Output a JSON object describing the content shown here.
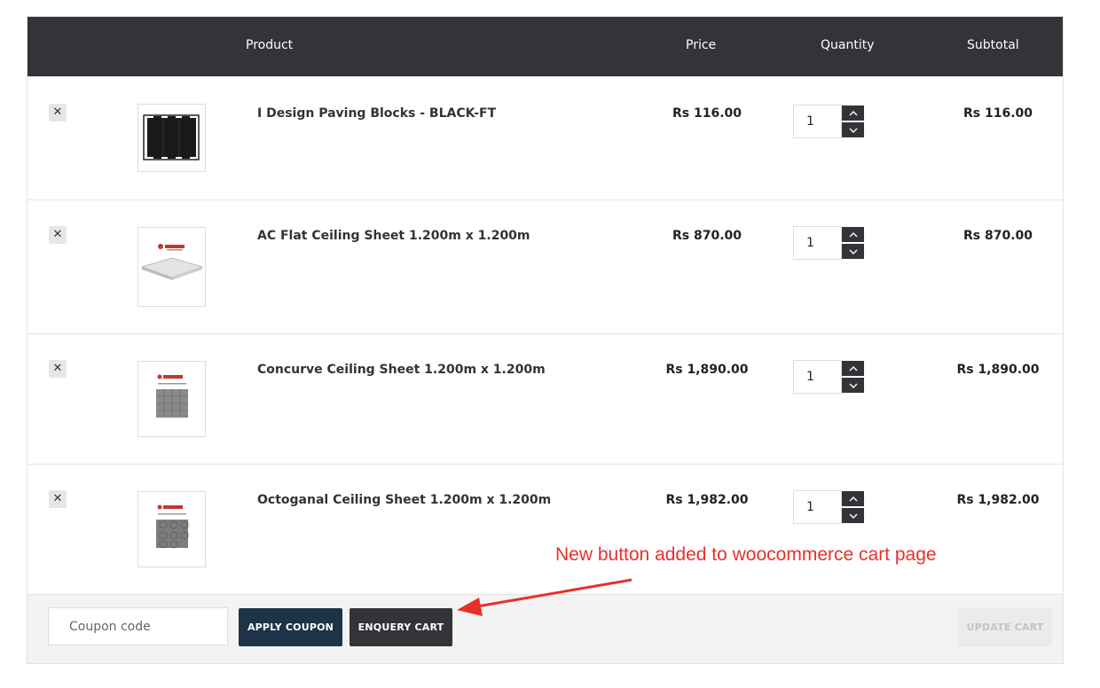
{
  "table": {
    "headers": {
      "product": "Product",
      "price": "Price",
      "quantity": "Quantity",
      "subtotal": "Subtotal"
    },
    "items": [
      {
        "name": "I Design Paving Blocks - BLACK-FT",
        "price": "Rs 116.00",
        "qty": "1",
        "subtotal": "Rs 116.00",
        "thumb": "black-paving-block"
      },
      {
        "name": "AC Flat Ceiling Sheet 1.200m x 1.200m",
        "price": "Rs 870.00",
        "qty": "1",
        "subtotal": "Rs 870.00",
        "thumb": "flat-ceiling-sheet"
      },
      {
        "name": "Concurve Ceiling Sheet 1.200m x 1.200m",
        "price": "Rs 1,890.00",
        "qty": "1",
        "subtotal": "Rs 1,890.00",
        "thumb": "concurve-ceiling-sheet"
      },
      {
        "name": "Octoganal Ceiling Sheet 1.200m x 1.200m",
        "price": "Rs 1,982.00",
        "qty": "1",
        "subtotal": "Rs 1,982.00",
        "thumb": "octagonal-ceiling-sheet"
      }
    ],
    "remove_glyph": "✕"
  },
  "actions": {
    "coupon_placeholder": "Coupon code",
    "apply_coupon": "APPLY COUPON",
    "enquery_cart": "ENQUERY CART",
    "update_cart": "UPDATE CART"
  },
  "annotation": {
    "text": "New button added to woocommerce cart page",
    "color": "#e8302a"
  },
  "colors": {
    "header_bg": "#333338",
    "apply_bg": "#1c3348",
    "enquery_bg": "#333338"
  }
}
